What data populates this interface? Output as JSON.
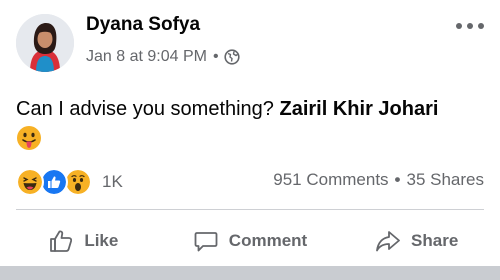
{
  "post": {
    "author": "Dyana Sofya",
    "timestamp": "Jan 8 at 9:04 PM",
    "separator": "•",
    "privacy_icon": "globe-icon",
    "text_main": "Can I advise you something? ",
    "mention": "Zairil Khir Johari",
    "trailing_emoji": "face-with-tongue"
  },
  "reactions": {
    "icons": [
      "haha",
      "like",
      "wow"
    ],
    "count": "1K"
  },
  "stats": {
    "comments": "951 Comments",
    "separator": "•",
    "shares": "35 Shares"
  },
  "actions": {
    "like_label": "Like",
    "comment_label": "Comment",
    "share_label": "Share"
  },
  "colors": {
    "secondary_text": "#65676b",
    "like_blue": "#1877f2",
    "emoji_yellow": "#f7b125",
    "divider": "#ced0d4"
  }
}
